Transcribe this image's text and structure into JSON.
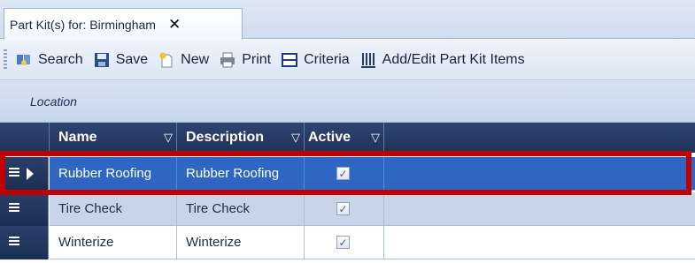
{
  "tab": {
    "title": "Part Kit(s) for: Birmingham",
    "close_glyph": "✕"
  },
  "toolbar": {
    "search": "Search",
    "save": "Save",
    "new": "New",
    "print": "Print",
    "criteria": "Criteria",
    "add_edit": "Add/Edit Part Kit Items"
  },
  "groupbar": {
    "label": "Location"
  },
  "grid": {
    "columns": {
      "name": "Name",
      "description": "Description",
      "active": "Active"
    },
    "filter_glyph": "▽",
    "rows": [
      {
        "name": "Rubber Roofing",
        "description": "Rubber Roofing",
        "active": true,
        "selected": true
      },
      {
        "name": "Tire Check",
        "description": "Tire Check",
        "active": true,
        "selected": false
      },
      {
        "name": "Winterize",
        "description": "Winterize",
        "active": true,
        "selected": false
      }
    ]
  },
  "colors": {
    "selection": "#2f66c4",
    "header": "#1f3259",
    "highlight": "#c00000"
  }
}
